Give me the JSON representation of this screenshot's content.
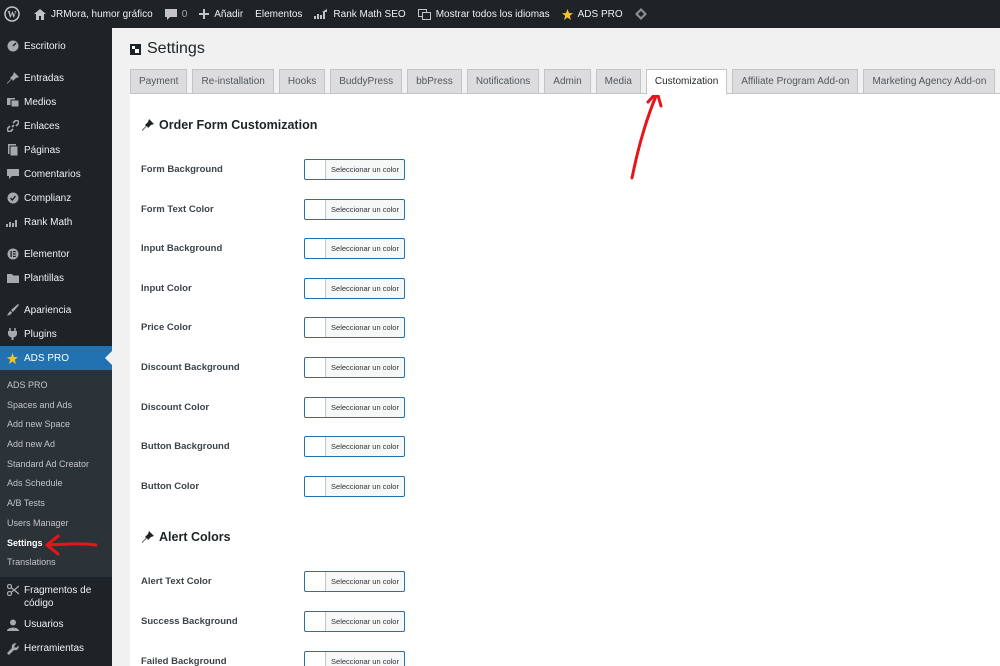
{
  "admin_bar": {
    "site_name": "JRMora, humor gráfico",
    "comments_count": "0",
    "add_new": "Añadir",
    "elementor": "Elementos",
    "rank_math": "Rank Math SEO",
    "languages": "Mostrar todos los idiomas",
    "ads_pro": "ADS PRO"
  },
  "sidebar": {
    "items_top": [
      {
        "label": "Escritorio",
        "icon": "dashboard-icon"
      },
      {
        "label": "Entradas",
        "icon": "pin-icon"
      },
      {
        "label": "Medios",
        "icon": "media-icon"
      },
      {
        "label": "Enlaces",
        "icon": "link-icon"
      },
      {
        "label": "Páginas",
        "icon": "page-icon"
      },
      {
        "label": "Comentarios",
        "icon": "comment-icon"
      },
      {
        "label": "Complianz",
        "icon": "shield-icon"
      },
      {
        "label": "Rank Math",
        "icon": "chart-icon"
      },
      {
        "label": "Elementor",
        "icon": "elementor-icon"
      },
      {
        "label": "Plantillas",
        "icon": "folder-icon"
      },
      {
        "label": "Apariencia",
        "icon": "brush-icon"
      },
      {
        "label": "Plugins",
        "icon": "plug-icon"
      }
    ],
    "active_item": {
      "label": "ADS PRO",
      "icon": "star-icon"
    },
    "submenu": [
      "ADS PRO",
      "Spaces and Ads",
      "Add new Space",
      "Add new Ad",
      "Standard Ad Creator",
      "Ads Schedule",
      "A/B Tests",
      "Users Manager",
      "Settings",
      "Translations"
    ],
    "current_submenu": "Settings",
    "items_bottom": [
      {
        "label": "Fragmentos de código",
        "icon": "scissors-icon"
      },
      {
        "label": "Usuarios",
        "icon": "user-icon"
      },
      {
        "label": "Herramientas",
        "icon": "wrench-icon"
      }
    ]
  },
  "page": {
    "title": "Settings",
    "tabs": [
      "Payment",
      "Re-installation",
      "Hooks",
      "BuddyPress",
      "bbPress",
      "Notifications",
      "Admin",
      "Media",
      "Customization",
      "Affiliate Program Add-on",
      "Marketing Agency Add-on"
    ],
    "active_tab": "Customization"
  },
  "sections": [
    {
      "title": "Order Form Customization",
      "fields": [
        "Form Background",
        "Form Text Color",
        "Input Background",
        "Input Color",
        "Price Color",
        "Discount Background",
        "Discount Color",
        "Button Background",
        "Button Color"
      ]
    },
    {
      "title": "Alert Colors",
      "fields": [
        "Alert Text Color",
        "Success Background",
        "Failed Background"
      ]
    }
  ],
  "color_button_label": "Seleccionar un color",
  "colors": {
    "admin_bg": "#1d2327",
    "accent": "#2271b1",
    "annotation": "#e8141a"
  }
}
